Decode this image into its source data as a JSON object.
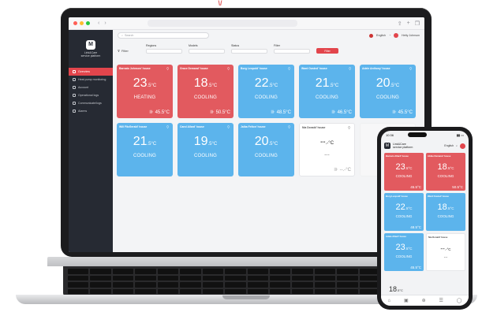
{
  "app": {
    "logo_text": "M",
    "brand_line1": "Link&Care",
    "brand_line2": "service platform"
  },
  "browser": {
    "dot_colors": [
      "#ff5f57",
      "#febc2e",
      "#28c840"
    ],
    "back_icon": "chevron-left-icon",
    "forward_icon": "chevron-right-icon"
  },
  "sidebar": {
    "items": [
      {
        "label": "Overview",
        "active": true
      },
      {
        "label": "Heat pump monitoring",
        "active": false
      },
      {
        "label": "Account",
        "active": false
      },
      {
        "label": "Operational logs",
        "active": false
      },
      {
        "label": "Communicate/logs",
        "active": false
      },
      {
        "label": "Alarms",
        "active": false
      }
    ]
  },
  "topbar": {
    "search_placeholder": "Search",
    "language": "English",
    "user_name": "Hetty Johnson"
  },
  "filters": {
    "filter_label": "Filter",
    "fields": [
      {
        "label": "Regions"
      },
      {
        "label": "Models"
      },
      {
        "label": "Status"
      },
      {
        "label": "Filter"
      }
    ],
    "button_label": "Filter"
  },
  "cards": [
    {
      "title": "Barnato Johnson' house",
      "temp": "23",
      "decimal": ".5°C",
      "mode": "HEATING",
      "room": "45.5°C",
      "state": "heat"
    },
    {
      "title": "Grace Demarai' house",
      "temp": "18",
      "decimal": ".5°C",
      "mode": "COOLING",
      "room": "50.5°C",
      "state": "heat"
    },
    {
      "title": "Borg Leopold' house",
      "temp": "22",
      "decimal": ".5°C",
      "mode": "COOLING",
      "room": "48.5°C",
      "state": "cool"
    },
    {
      "title": "Ward Ousted' house",
      "temp": "21",
      "decimal": ".5°C",
      "mode": "COOLING",
      "room": "46.5°C",
      "state": "cool"
    },
    {
      "title": "Adele Anthony' house",
      "temp": "20",
      "decimal": ".5°C",
      "mode": "COOLING",
      "room": "45.5°C",
      "state": "cool"
    },
    {
      "title": "Will FitzGerald' house",
      "temp": "21",
      "decimal": ".5°C",
      "mode": "COOLING",
      "room": "",
      "state": "cool"
    },
    {
      "title": "Carol Allard' house",
      "temp": "19",
      "decimal": ".5°C",
      "mode": "COOLING",
      "room": "",
      "state": "cool"
    },
    {
      "title": "Jalba Felton' house",
      "temp": "20",
      "decimal": ".5°C",
      "mode": "COOLING",
      "room": "",
      "state": "cool"
    },
    {
      "title": "Nia Donald' house",
      "temp": "--",
      "decimal": ".-°C",
      "mode": "---",
      "room": "--.-°C",
      "state": "off"
    }
  ],
  "phone": {
    "time": "10:36",
    "brand_line1": "Link&Care",
    "brand_line2": "service platform",
    "language": "English",
    "cards": [
      {
        "title": "Barnato Allard' house",
        "temp": "23",
        "decimal": ".5°C",
        "mode": "COOLING",
        "room": "45.5°C",
        "state": "heat"
      },
      {
        "title": "Abbie Demarai' house",
        "temp": "18",
        "decimal": ".5°C",
        "mode": "COOLING",
        "room": "50.5°C",
        "state": "heat"
      },
      {
        "title": "Borg Leopold' house",
        "temp": "22",
        "decimal": ".5°C",
        "mode": "COOLING",
        "room": "48.5°C",
        "state": "cool"
      },
      {
        "title": "Ward Ousted' house",
        "temp": "18",
        "decimal": ".5°C",
        "mode": "COOLING",
        "room": "",
        "state": "cool"
      },
      {
        "title": "Adele Allard' house",
        "temp": "23",
        "decimal": ".5°C",
        "mode": "COOLING",
        "room": "45.5°C",
        "state": "cool"
      },
      {
        "title": "Nia Donald' house",
        "temp": "--",
        "decimal": ".-°C",
        "mode": "---",
        "room": "",
        "state": "off"
      }
    ],
    "bottom_temp": "18",
    "bottom_decimal": ".5°C"
  }
}
